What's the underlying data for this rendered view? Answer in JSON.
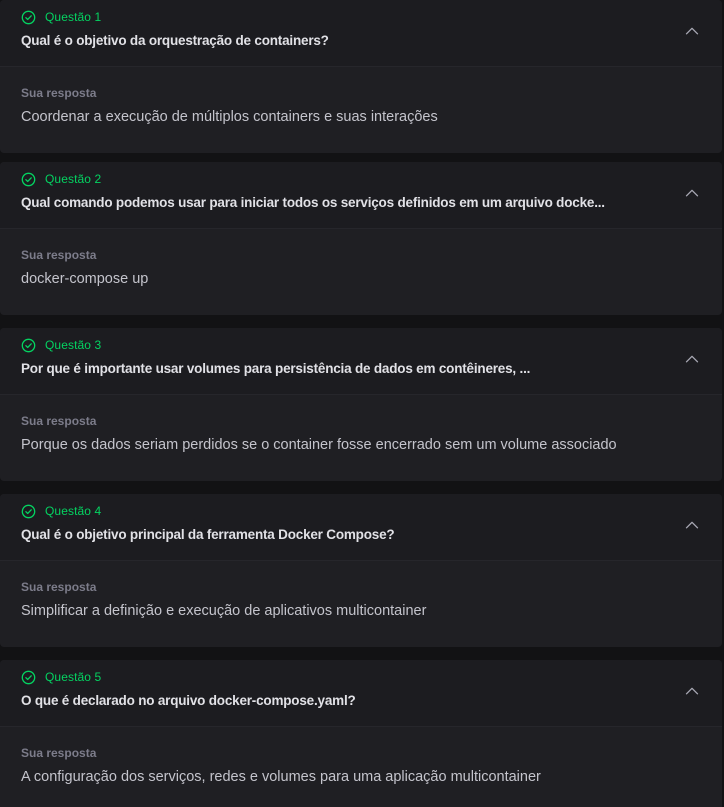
{
  "colors": {
    "accent": "#04d361",
    "background": "#121214",
    "card": "#1f1f23",
    "question_text": "#e1e1e6",
    "muted_text": "#7c7c8a"
  },
  "questions": [
    {
      "status_icon": "check-circle-icon",
      "label": "Questão 1",
      "question": "Qual é o objetivo da orquestração de containers?",
      "answer_label": "Sua resposta",
      "answer": "Coordenar a execução de múltiplos containers e suas interações",
      "toggle_icon": "chevron-up-icon"
    },
    {
      "status_icon": "check-circle-icon",
      "label": "Questão 2",
      "question": "Qual comando podemos usar para iniciar todos os serviços definidos em um arquivo docke...",
      "answer_label": "Sua resposta",
      "answer": "docker-compose up",
      "toggle_icon": "chevron-up-icon"
    },
    {
      "status_icon": "check-circle-icon",
      "label": "Questão 3",
      "question": "Por que é importante usar volumes para persistência de dados em contêineres, ...",
      "answer_label": "Sua resposta",
      "answer": "Porque os dados seriam perdidos se o container fosse encerrado sem um volume associado",
      "toggle_icon": "chevron-up-icon"
    },
    {
      "status_icon": "check-circle-icon",
      "label": "Questão 4",
      "question": "Qual é o objetivo principal da ferramenta Docker Compose?",
      "answer_label": "Sua resposta",
      "answer": "Simplificar a definição e execução de aplicativos multicontainer",
      "toggle_icon": "chevron-up-icon"
    },
    {
      "status_icon": "check-circle-icon",
      "label": "Questão 5",
      "question": "O que é declarado no arquivo docker-compose.yaml?",
      "answer_label": "Sua resposta",
      "answer": "A configuração dos serviços, redes e volumes para uma aplicação multicontainer",
      "toggle_icon": "chevron-up-icon"
    }
  ]
}
